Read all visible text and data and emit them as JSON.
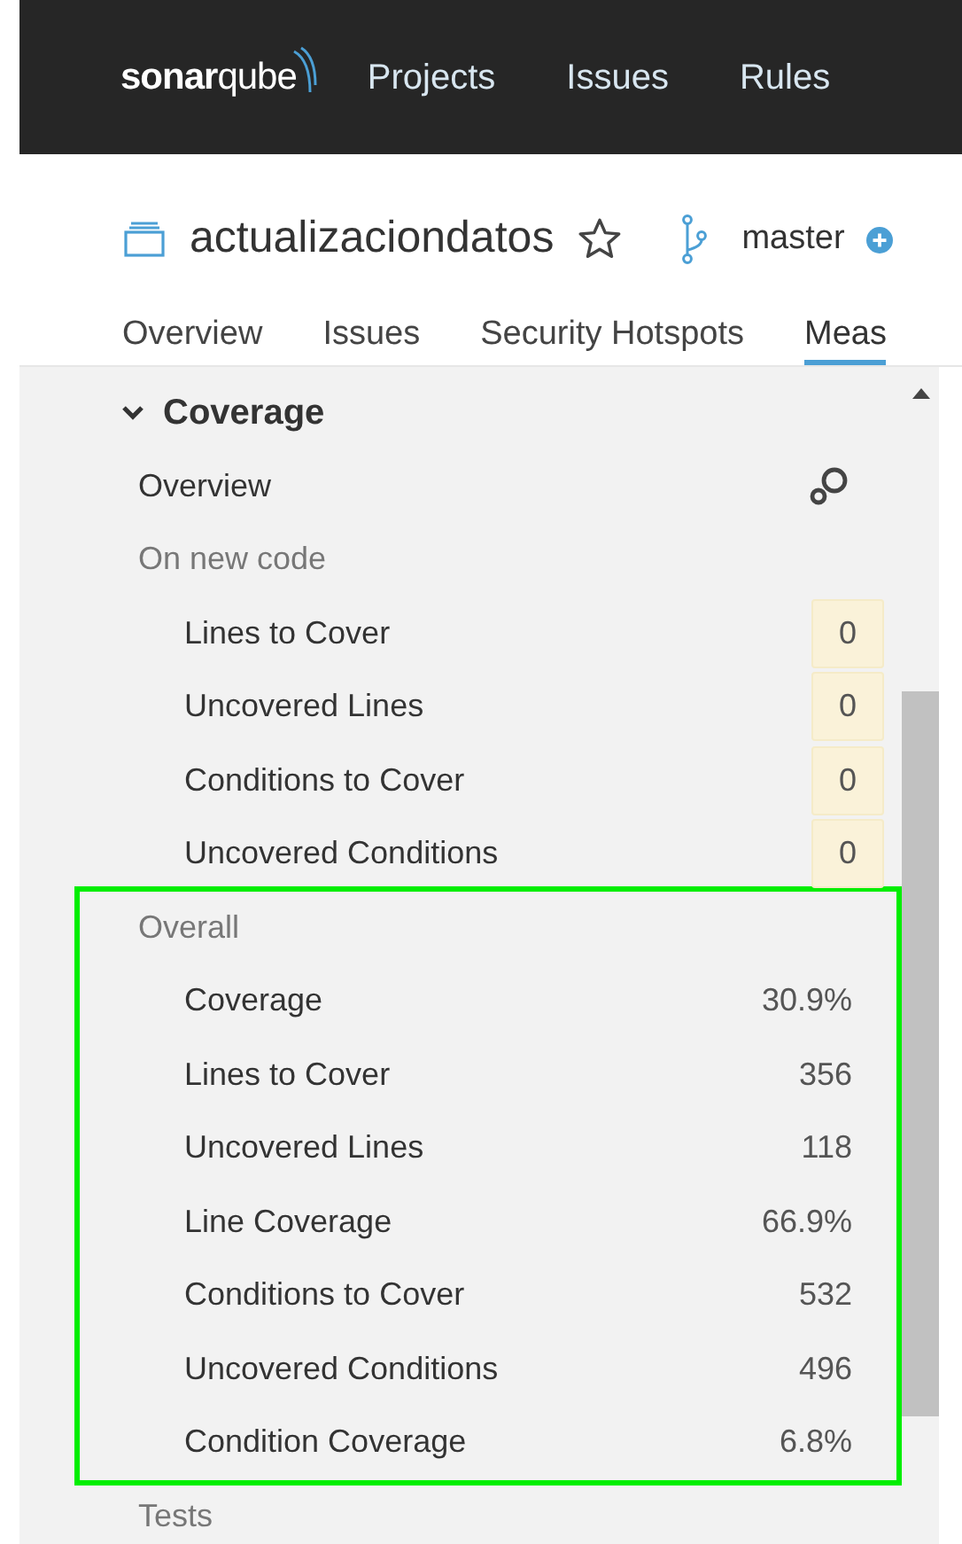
{
  "navbar": {
    "logo": "**sonar**qube",
    "items": [
      {
        "label": "Projects"
      },
      {
        "label": "Issues"
      },
      {
        "label": "Rules"
      }
    ]
  },
  "project": {
    "name": "actualizaciondatos",
    "starred": false,
    "branch": "master"
  },
  "tabs": [
    {
      "label": "Overview",
      "selected": false
    },
    {
      "label": "Issues",
      "selected": false
    },
    {
      "label": "Security Hotspots",
      "selected": false
    },
    {
      "label": "Meas",
      "selected": true
    }
  ],
  "sidebar": {
    "domain": {
      "title": "Coverage",
      "expanded": true
    },
    "overview": {
      "label": "Overview"
    },
    "sections": [
      {
        "label": "On new code",
        "highlighted": false,
        "kind": "new_code",
        "metrics": [
          {
            "name": "Lines to Cover",
            "value": "0"
          },
          {
            "name": "Uncovered Lines",
            "value": "0"
          },
          {
            "name": "Conditions to Cover",
            "value": "0"
          },
          {
            "name": "Uncovered Conditions",
            "value": "0"
          }
        ]
      },
      {
        "label": "Overall",
        "highlighted": true,
        "kind": "overall",
        "metrics": [
          {
            "name": "Coverage",
            "value": "30.9%"
          },
          {
            "name": "Lines to Cover",
            "value": "356"
          },
          {
            "name": "Uncovered Lines",
            "value": "118"
          },
          {
            "name": "Line Coverage",
            "value": "66.9%"
          },
          {
            "name": "Conditions to Cover",
            "value": "532"
          },
          {
            "name": "Uncovered Conditions",
            "value": "496"
          },
          {
            "name": "Condition Coverage",
            "value": "6.8%"
          }
        ]
      }
    ],
    "next_domain": {
      "title": "Tests"
    }
  }
}
